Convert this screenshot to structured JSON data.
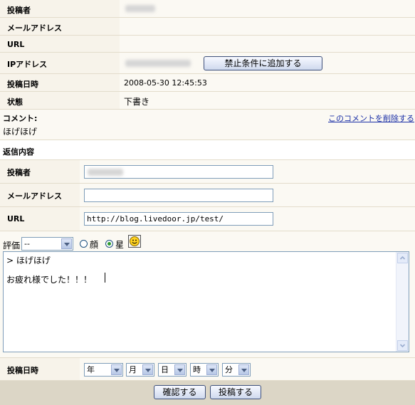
{
  "info": {
    "poster_label": "投稿者",
    "email_label": "メールアドレス",
    "url_label": "URL",
    "ip_label": "IPアドレス",
    "ban_button": "禁止条件に追加する",
    "date_label": "投稿日時",
    "date_value": "2008-05-30 12:45:53",
    "status_label": "状態",
    "status_value": "下書き"
  },
  "comment": {
    "label": "コメント:",
    "body": "ほげほげ",
    "delete_link": "このコメントを削除する"
  },
  "reply": {
    "header": "返信内容",
    "poster_label": "投稿者",
    "poster_value": "",
    "email_label": "メールアドレス",
    "email_value": "",
    "url_label": "URL",
    "url_value": "http://blog.livedoor.jp/test/",
    "rating_label": "評価",
    "rating_selected": "--",
    "radio_face": "顔",
    "radio_star": "星",
    "textarea_line1": "> ほげほげ",
    "textarea_line2": "お疲れ様でした！！！",
    "post_date_label": "投稿日時",
    "year": "年",
    "month": "月",
    "day": "日",
    "hour": "時",
    "minute": "分",
    "confirm_button": "確認する",
    "post_button": "投稿する"
  },
  "colors": {
    "label_bg": "#f7f3ea",
    "value_bg": "#fbf9f3",
    "footer_bg": "#dcd6c6",
    "link": "#1a2fa6"
  }
}
